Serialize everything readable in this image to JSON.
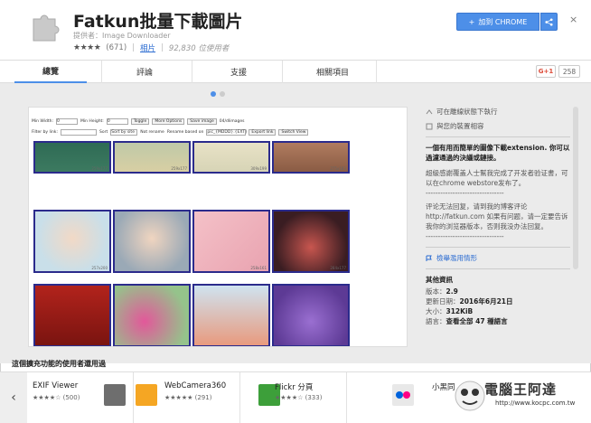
{
  "header": {
    "title": "Fatkun批量下載圖片",
    "provider": "提供者：Image Downloader",
    "rating_stars": "★★★★",
    "rating_count": "(671)",
    "category": "相片",
    "users": "92,830 位使用者",
    "add_button": "加到 CHROME",
    "add_icon": "+",
    "share_icon": "share-icon",
    "close_icon": "×"
  },
  "tabs": [
    {
      "label": "總覽",
      "active": true
    },
    {
      "label": "評論",
      "active": false
    },
    {
      "label": "支援",
      "active": false
    },
    {
      "label": "相關項目",
      "active": false
    }
  ],
  "social": {
    "gplus_label": "G+1",
    "count": "258"
  },
  "screenshot": {
    "toolbar1": [
      "Min Width:",
      "0",
      "Min Height:",
      "0",
      "Toggle",
      "More Options",
      "Save image",
      "04/dlimages"
    ],
    "toolbar2": [
      "Filter by link:",
      "Sort",
      "Sort by site",
      "Not rename",
      "Rename based on",
      "pic_{MDDD}.{EXT}",
      "Export link",
      "Switch View"
    ],
    "captions": [
      "259x177",
      "259x177",
      "309x199",
      "275x183",
      "257x200",
      "",
      "258x161",
      "284x177",
      "",
      "",
      "",
      ""
    ]
  },
  "sidebar": {
    "offline": "可在離線狀態下執行",
    "works_with": "與您的裝置相容",
    "headline": "一個有用而簡單的圖像下載extension. 你可以過濾通過的決議或鏈接。",
    "para1": "超級感謝覆盖人士幫我完成了开发者验证書，可以在chrome webstore发布了。",
    "dashes": "--------------------------------",
    "para2": "评论无法回复，请到我的博客评论 http://fatkun.com 如果有问题，请一定要告诉我你的浏览器版本，否则我没办法回复。",
    "dashes2": "--------------------------------",
    "report": "檢舉濫用情形",
    "info_title": "其他資訊",
    "version_label": "版本：",
    "version": "2.9",
    "updated_label": "更新日期：",
    "updated": "2016年6月21日",
    "size_label": "大小：",
    "size": "312KiB",
    "lang_label": "語言：",
    "lang": "查看全部 47 種語言"
  },
  "related": {
    "title": "這個擴充功能的使用者還用過",
    "items": [
      {
        "name": "EXIF Viewer",
        "stars": "★★★★☆",
        "count": "(500)"
      },
      {
        "name": "WebCamera360",
        "stars": "★★★★★",
        "count": "(291)"
      },
      {
        "name": "Flickr 分頁",
        "stars": "★★★★☆",
        "count": "(333)"
      },
      {
        "name": "小黑同",
        "stars": "★★★★☆",
        "count": ""
      }
    ]
  },
  "watermark": {
    "text": "電腦王阿達",
    "url": "http://www.kocpc.com.tw"
  },
  "colors": {
    "accent": "#4d8fe8",
    "link": "#2a6bd1",
    "gplus": "#dd4b39"
  }
}
